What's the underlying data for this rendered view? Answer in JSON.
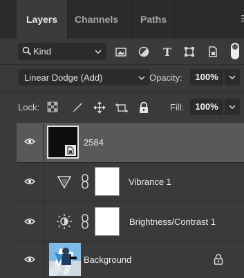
{
  "tabs": [
    {
      "label": "Layers",
      "active": true
    },
    {
      "label": "Channels",
      "active": false
    },
    {
      "label": "Paths",
      "active": false
    }
  ],
  "filter": {
    "kind_label": "Kind",
    "icons": [
      "pixel-filter-icon",
      "adjustment-filter-icon",
      "type-filter-icon",
      "shape-filter-icon",
      "smart-object-filter-icon"
    ]
  },
  "blend": {
    "mode": "Linear Dodge (Add)",
    "opacity_label": "Opacity:",
    "opacity_value": "100%"
  },
  "lock": {
    "label": "Lock:",
    "fill_label": "Fill:",
    "fill_value": "100%"
  },
  "layers": [
    {
      "name": "2584",
      "type": "smart-object",
      "selected": true,
      "visible": true
    },
    {
      "name": "Vibrance 1",
      "type": "vibrance-adjustment",
      "selected": false,
      "visible": true
    },
    {
      "name": "Brightness/Contrast 1",
      "type": "brightness-contrast-adjustment",
      "selected": false,
      "visible": true
    },
    {
      "name": "Background",
      "type": "background",
      "selected": false,
      "visible": true,
      "locked": true
    }
  ],
  "colors": {
    "panel_bg": "#3a3a3a",
    "tab_bar_bg": "#2b2b2b",
    "selected_layer_bg": "#595959",
    "field_bg": "#2b2b2b"
  }
}
